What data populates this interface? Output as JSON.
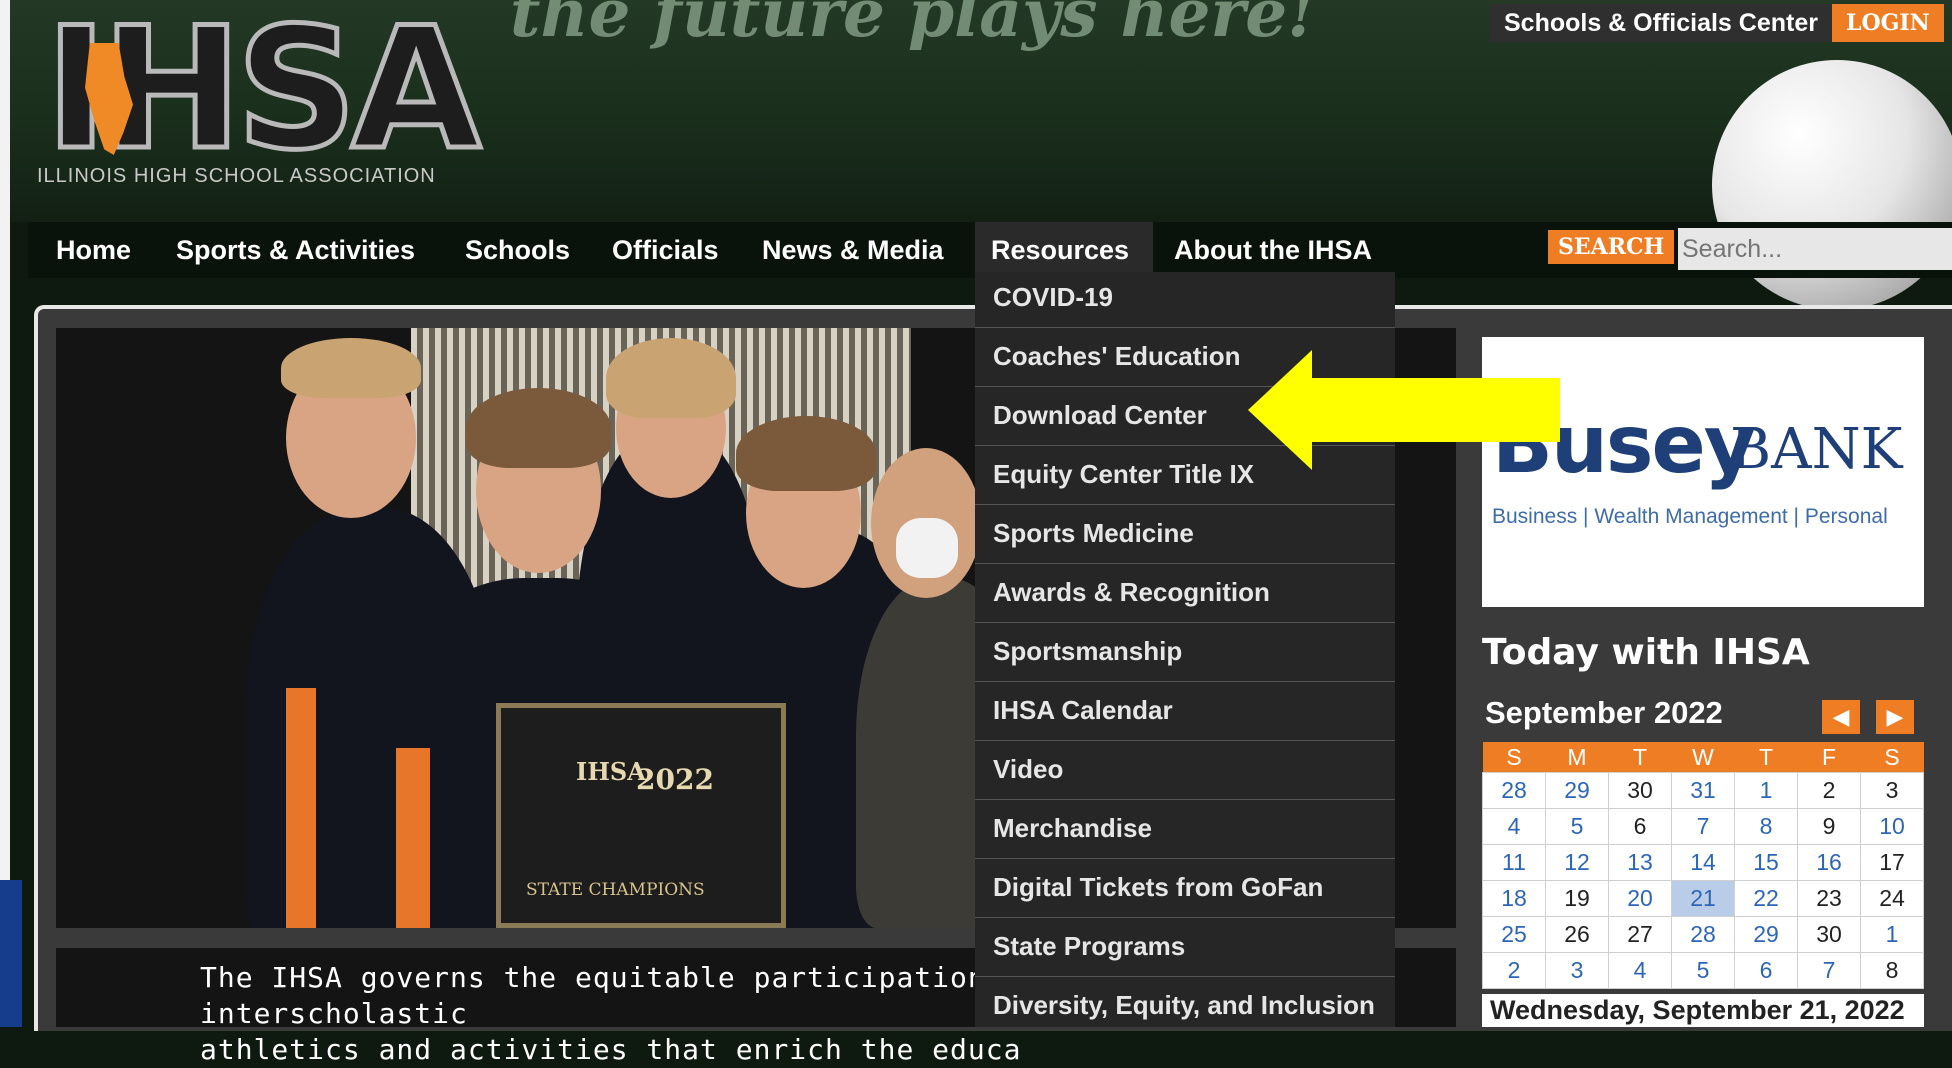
{
  "header": {
    "logo_text": "IHSA",
    "logo_subtitle": "ILLINOIS HIGH SCHOOL ASSOCIATION",
    "tagline": "the future plays here!",
    "schools_officials_center": "Schools & Officials Center",
    "login_label": "LOGIN"
  },
  "nav": {
    "items": [
      {
        "label": "Home"
      },
      {
        "label": "Sports & Activities"
      },
      {
        "label": "Schools"
      },
      {
        "label": "Officials"
      },
      {
        "label": "News & Media"
      },
      {
        "label": "Resources"
      },
      {
        "label": "About the IHSA"
      }
    ],
    "search_button": "SEARCH",
    "search_placeholder": "Search..."
  },
  "resources_menu": {
    "items": [
      {
        "label": "COVID-19"
      },
      {
        "label": "Coaches' Education"
      },
      {
        "label": "Download Center"
      },
      {
        "label": "Equity Center Title IX"
      },
      {
        "label": "Sports Medicine"
      },
      {
        "label": "Awards & Recognition"
      },
      {
        "label": "Sportsmanship"
      },
      {
        "label": "IHSA Calendar"
      },
      {
        "label": "Video"
      },
      {
        "label": "Merchandise"
      },
      {
        "label": "Digital Tickets from GoFan"
      },
      {
        "label": "State Programs"
      },
      {
        "label": "Diversity, Equity, and Inclusion"
      }
    ]
  },
  "hero": {
    "plaque_letters": "IHSA",
    "plaque_year": "2022",
    "plaque_footer": "STATE CHAMPIONS"
  },
  "mission": {
    "line1": "The IHSA governs the equitable participation in interscholastic",
    "line2": "athletics and activities that enrich the educa"
  },
  "ad": {
    "brand": "Busey",
    "bank": "BANK",
    "tagline": "Business | Wealth Management | Personal"
  },
  "sidebar": {
    "title": "Today with IHSA",
    "calendar": {
      "month": "September 2022",
      "prev_icon": "◀",
      "next_icon": "▶",
      "weekdays": [
        "S",
        "M",
        "T",
        "W",
        "T",
        "F",
        "S"
      ],
      "weeks": [
        [
          "28",
          "29",
          "30",
          "31",
          "1",
          "2",
          "3"
        ],
        [
          "4",
          "5",
          "6",
          "7",
          "8",
          "9",
          "10"
        ],
        [
          "11",
          "12",
          "13",
          "14",
          "15",
          "16",
          "17"
        ],
        [
          "18",
          "19",
          "20",
          "21",
          "22",
          "23",
          "24"
        ],
        [
          "25",
          "26",
          "27",
          "28",
          "29",
          "30",
          "1"
        ],
        [
          "2",
          "3",
          "4",
          "5",
          "6",
          "7",
          "8"
        ]
      ],
      "selected_date": "Wednesday, September 21, 2022"
    }
  },
  "colors": {
    "accent_orange": "#ee7d24",
    "arrow_yellow": "#ffff00",
    "nav_bg": "#0a130b"
  }
}
